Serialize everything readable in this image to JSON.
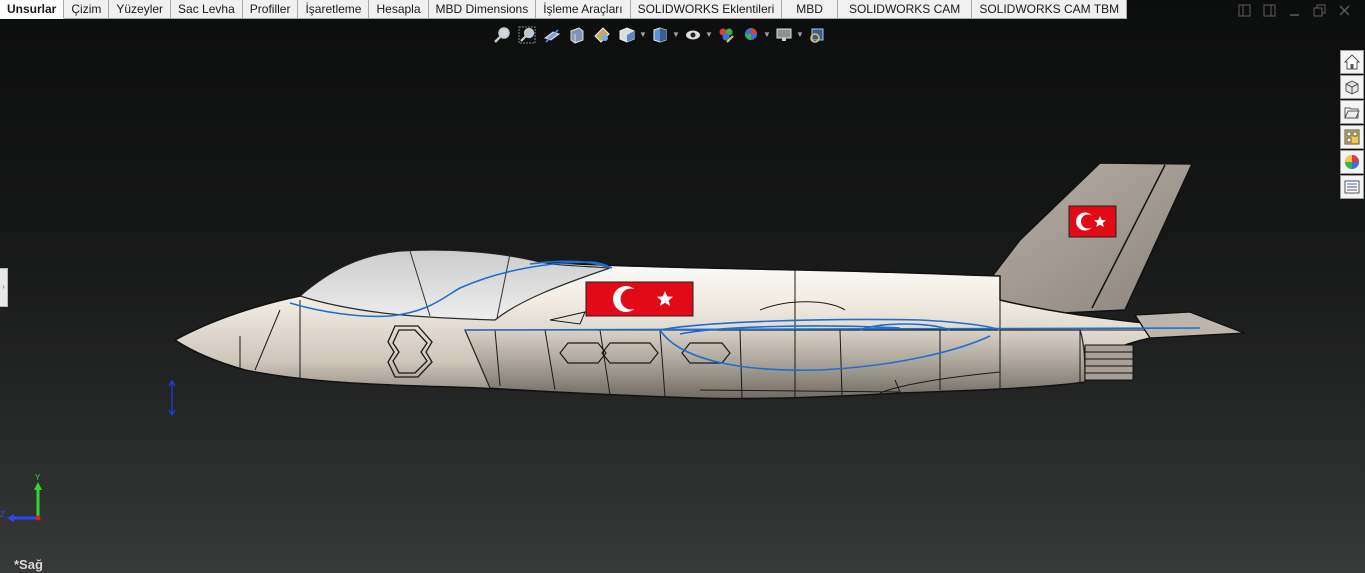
{
  "tabs": [
    {
      "label": "Unsurlar",
      "active": true
    },
    {
      "label": "Çizim"
    },
    {
      "label": "Yüzeyler"
    },
    {
      "label": "Sac Levha"
    },
    {
      "label": "Profiller"
    },
    {
      "label": "İşaretleme"
    },
    {
      "label": "Hesapla"
    },
    {
      "label": "MBD Dimensions"
    },
    {
      "label": "İşleme Araçları"
    },
    {
      "label": "SOLIDWORKS Eklentileri"
    },
    {
      "label": "MBD"
    },
    {
      "label": "SOLIDWORKS CAM"
    },
    {
      "label": "SOLIDWORKS CAM TBM"
    }
  ],
  "hud_icons": [
    "zoom-to-fit-icon",
    "zoom-to-area-icon",
    "previous-view-icon",
    "section-view-icon",
    "dynamic-annotation-views-icon",
    "view-orientation-icon",
    "display-style-icon",
    "hide-show-items-icon",
    "edit-appearance-icon",
    "apply-scene-icon",
    "view-settings-icon",
    "rotate-view-icon"
  ],
  "taskpane_icons": [
    "solidworks-resources-icon",
    "design-library-icon",
    "file-explorer-icon",
    "view-palette-icon",
    "appearances-icon",
    "custom-properties-icon"
  ],
  "triad": {
    "y_label": "Y",
    "z_label": "Z"
  },
  "view_label": "*Sağ",
  "colors": {
    "flag_red": "#e30a17",
    "sketch_blue": "#1f6fd0",
    "fuselage": "#e8dfd3",
    "tail": "#a39b92"
  }
}
